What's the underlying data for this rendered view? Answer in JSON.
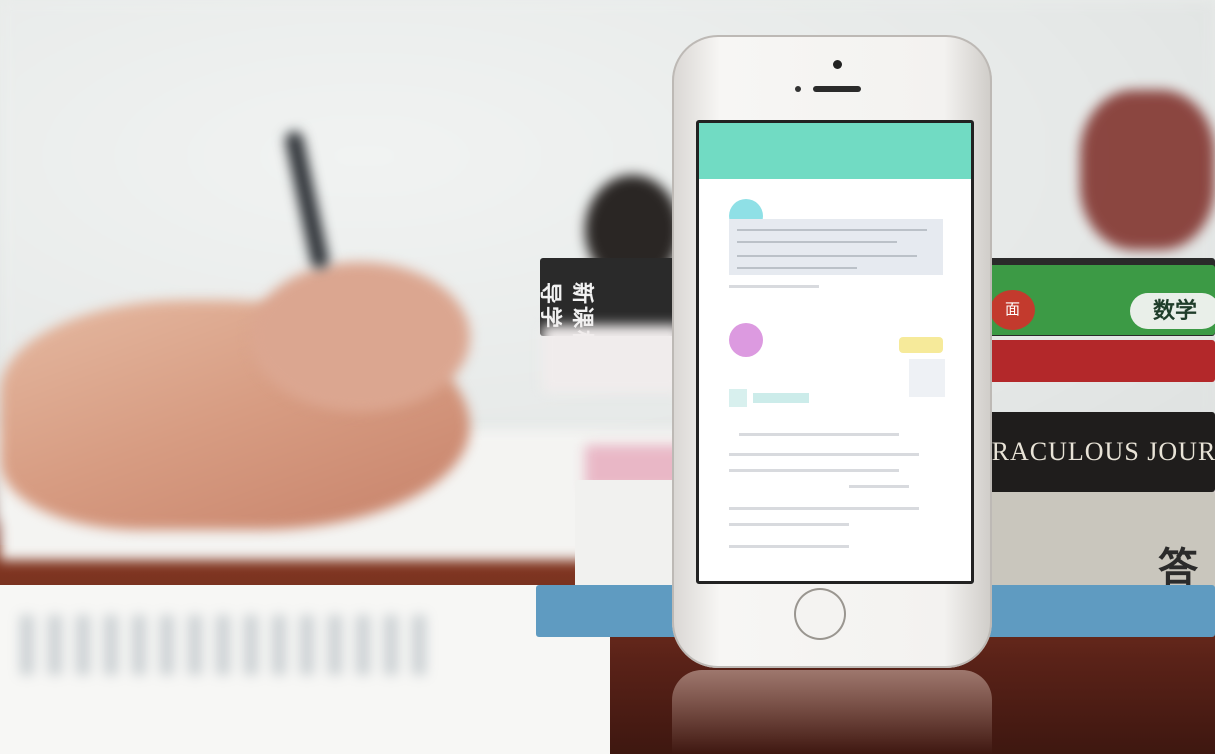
{
  "scene": {
    "description_free": true
  },
  "books": {
    "green_spine_text": "新课标导学",
    "math_badge": "数学",
    "red_logo": "面",
    "red_book_text": "",
    "black_book_title": "IRACULOUS JOUR",
    "beige_book_char": "答",
    "beige_book_small": ""
  },
  "phone": {
    "screen_title": ""
  },
  "colors": {
    "desk": "#5a2218",
    "screen_header": "#71dbc3",
    "book_green": "#3c9a45",
    "book_red": "#b3282a",
    "book_blue": "#5f9bc1"
  },
  "icons": [
    "pen-icon",
    "home-button-icon"
  ]
}
